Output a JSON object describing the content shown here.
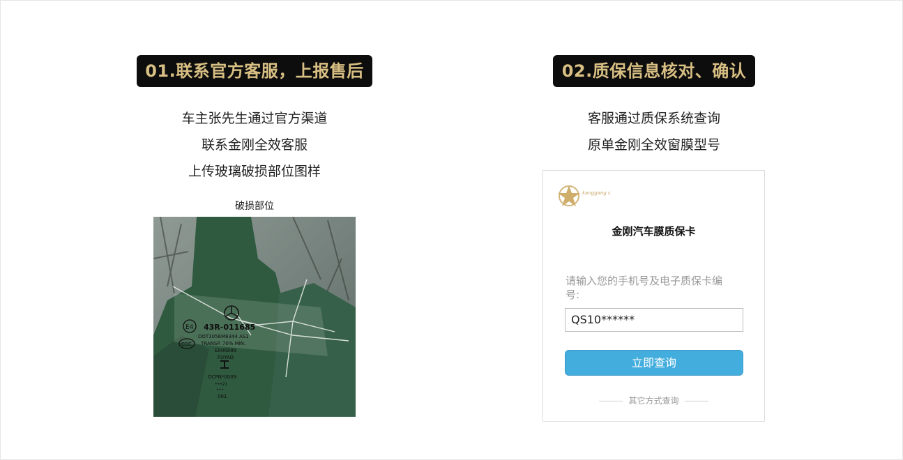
{
  "step1": {
    "badge": "01.联系官方客服，上报售后",
    "lines": [
      "车主张先生通过官方渠道",
      "联系金刚全效客服",
      "上传玻璃破损部位图样"
    ],
    "caption": "破损部位",
    "photo_text": [
      "43R-011685",
      "DOT1056M8344 AS1",
      "TRANSP. 70% MIN.",
      "E006888",
      "FUYAO",
      "OCPN*0009",
      "•••21",
      "•••",
      "001"
    ]
  },
  "step2": {
    "badge": "02.质保信息核对、确认",
    "lines": [
      "客服通过质保系统查询",
      "原单金刚全效窗膜型号"
    ],
    "card": {
      "brand": "kanggang c",
      "title": "金刚汽车膜质保卡",
      "prompt": "请输入您的手机号及电子质保卡编号:",
      "input_value": "QS10******",
      "button": "立即查询",
      "other_link": "其它方式查询"
    }
  },
  "colors": {
    "badge_bg": "#0d0d0d",
    "badge_text": "#d8bf83",
    "button_bg": "#43aede"
  }
}
